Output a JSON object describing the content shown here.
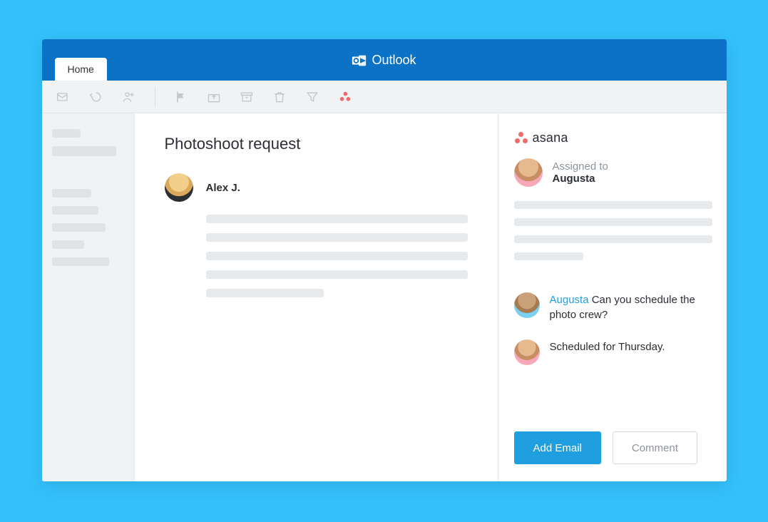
{
  "header": {
    "app_name": "Outlook",
    "tab_label": "Home"
  },
  "email": {
    "subject": "Photoshoot request",
    "sender_name": "Alex J."
  },
  "asana": {
    "brand": "asana",
    "assigned_label": "Assigned to",
    "assigned_to": "Augusta",
    "comments": [
      {
        "author": "Augusta",
        "mention": "Augusta",
        "text": "Can you schedule the photo crew?"
      },
      {
        "author": "Augusta",
        "text": "Scheduled for Thursday."
      }
    ],
    "actions": {
      "add_email": "Add Email",
      "comment": "Comment"
    }
  }
}
